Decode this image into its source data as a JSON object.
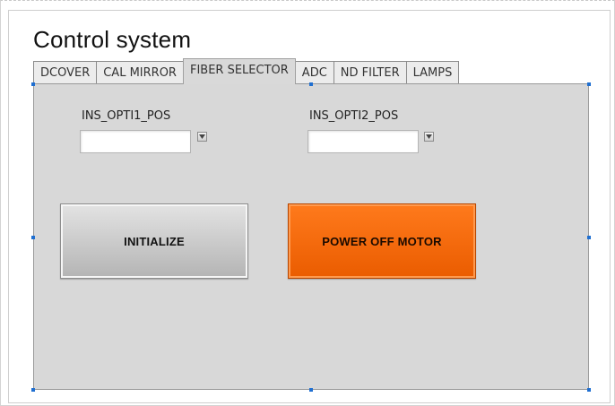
{
  "window": {
    "title": "Control system"
  },
  "tabs": [
    {
      "label": "DCOVER",
      "active": false
    },
    {
      "label": "CAL MIRROR",
      "active": false
    },
    {
      "label": "FIBER SELECTOR",
      "active": true
    },
    {
      "label": "ADC",
      "active": false
    },
    {
      "label": "ND FILTER",
      "active": false
    },
    {
      "label": "LAMPS",
      "active": false
    }
  ],
  "fiber_selector": {
    "opti1": {
      "label": "INS_OPTI1_POS",
      "value": ""
    },
    "opti2": {
      "label": "INS_OPTI2_POS",
      "value": ""
    },
    "initialize_label": "INITIALIZE",
    "power_off_label": "POWER OFF MOTOR"
  },
  "colors": {
    "panel_bg": "#d8d8d8",
    "initialize_button": "#c8c8c8",
    "power_off_button": "#f26a0f",
    "selection_handle": "#1f6fd1"
  },
  "icons": {
    "dropdown": "dropdown-arrow-icon",
    "handle": "selection-handle-icon"
  }
}
